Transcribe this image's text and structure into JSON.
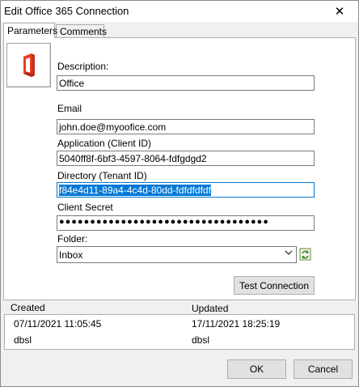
{
  "window": {
    "title": "Edit Office 365 Connection",
    "close_glyph": "✕"
  },
  "tabs": [
    {
      "label": "Parameters"
    },
    {
      "label": "Comments"
    }
  ],
  "form": {
    "description_label": "Description:",
    "description_value": "Office",
    "email_label": "Email",
    "email_value": "john.doe@myoofice.com",
    "client_id_label": "Application (Client ID)",
    "client_id_value": "5040ff8f-6bf3-4597-8064-fdfgdgd2",
    "tenant_id_label": "Directory (Tenant ID)",
    "tenant_id_value": "f84e4d11-89a4-4c4d-80dd-fdfdfdfdf",
    "secret_label": "Client Secret",
    "secret_value": "●●●●●●●●●●●●●●●●●●●●●●●●●●●●●●●●●●",
    "folder_label": "Folder:",
    "folder_value": "Inbox",
    "test_button": "Test Connection"
  },
  "info": {
    "created_label": "Created",
    "updated_label": "Updated",
    "created_date": "07/11/2021 11:05:45",
    "created_by": "dbsl",
    "updated_date": "17/11/2021 18:25:19",
    "updated_by": "dbsl"
  },
  "buttons": {
    "ok": "OK",
    "cancel": "Cancel"
  },
  "colors": {
    "accent": "#0078d7",
    "office_red": "#d83b01"
  },
  "icons": {
    "logo": "office-365-logo-icon",
    "refresh": "refresh-folder-icon",
    "dropdown": "chevron-down-icon"
  }
}
